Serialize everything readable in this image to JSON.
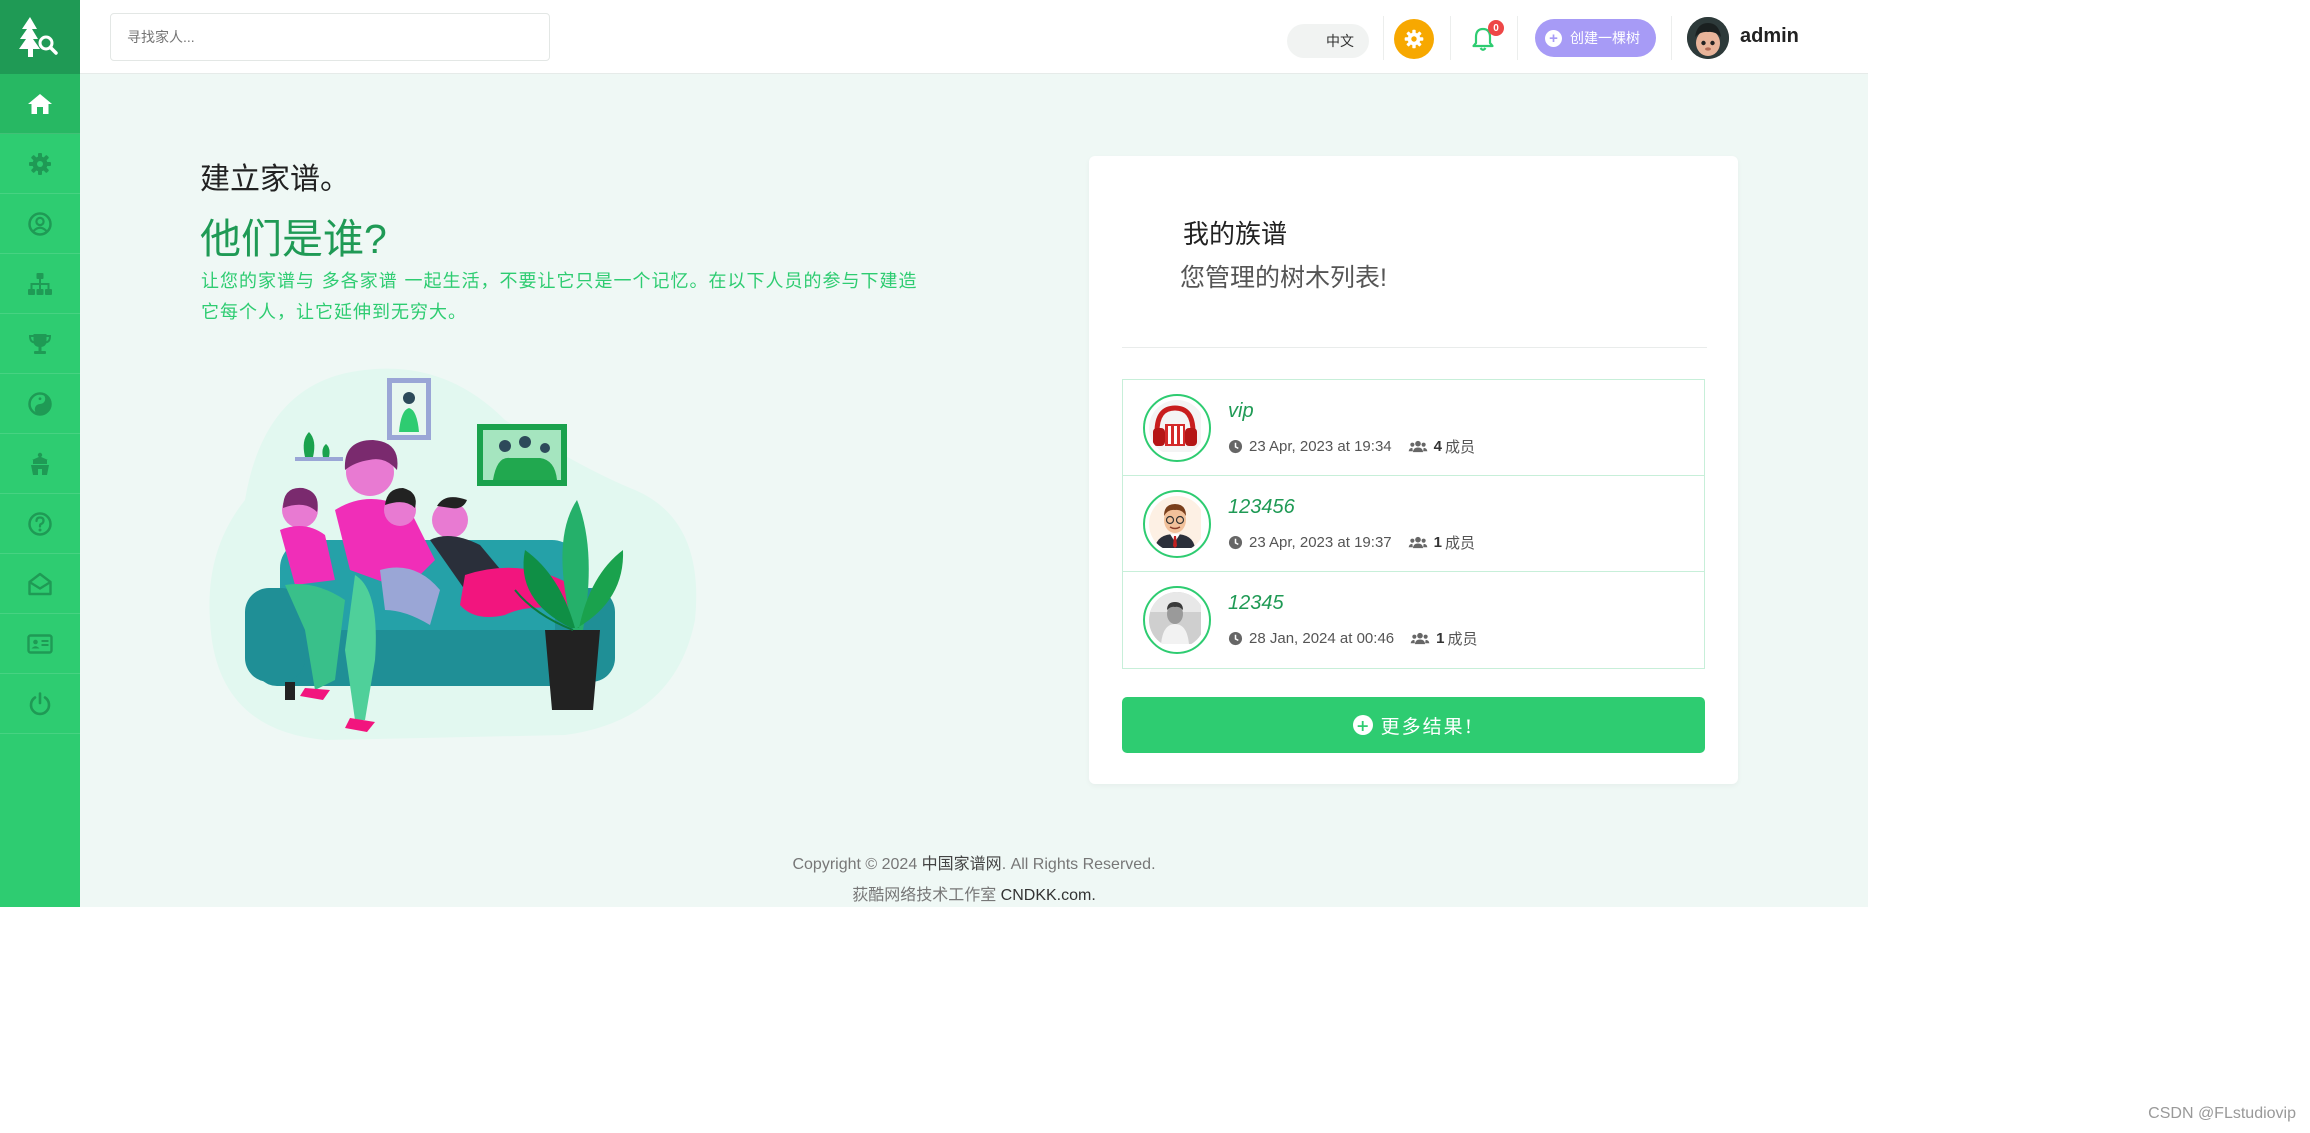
{
  "header": {
    "search_placeholder": "寻找家人...",
    "language": "中文",
    "notification_count": "0",
    "create_button": "创建一棵树",
    "user_name": "admin"
  },
  "sidebar": {
    "items": [
      {
        "icon": "home-icon",
        "active": true
      },
      {
        "icon": "gear-icon",
        "active": false
      },
      {
        "icon": "user-circle-icon",
        "active": false
      },
      {
        "icon": "sitemap-icon",
        "active": false
      },
      {
        "icon": "trophy-icon",
        "active": false
      },
      {
        "icon": "yin-yang-icon",
        "active": false
      },
      {
        "icon": "temple-icon",
        "active": false
      },
      {
        "icon": "question-icon",
        "active": false
      },
      {
        "icon": "envelope-open-icon",
        "active": false
      },
      {
        "icon": "id-card-icon",
        "active": false
      },
      {
        "icon": "power-icon",
        "active": false
      }
    ]
  },
  "hero": {
    "headline": "建立家谱。",
    "title": "他们是谁?",
    "description": "让您的家谱与 多各家谱 一起生活，不要让它只是一个记忆。在以下人员的参与下建造它每个人，让它延伸到无穷大。"
  },
  "card": {
    "title": "我的族谱",
    "subtitle": "您管理的树木列表!",
    "trees": [
      {
        "name": "vip",
        "date": "23 Apr, 2023 at 19:34",
        "members": "4",
        "members_unit": "成员"
      },
      {
        "name": "123456",
        "date": "23 Apr, 2023 at 19:37",
        "members": "1",
        "members_unit": "成员"
      },
      {
        "name": "12345",
        "date": "28 Jan, 2024 at 00:46",
        "members": "1",
        "members_unit": "成员"
      }
    ],
    "more_button": "更多结果!"
  },
  "footer": {
    "copyright_prefix": "Copyright © 2024",
    "site_name": "中国家谱网",
    "copyright_suffix": ". All Rights Reserved.",
    "studio": "荻酷网络技术工作室",
    "studio_site": "CNDKK.com."
  },
  "watermark": "CSDN @FLstudiovip",
  "colors": {
    "brand_green": "#2ecc71",
    "dark_green": "#1f9a55",
    "accent_purple": "#a79bf6",
    "accent_orange": "#f7a800",
    "badge_red": "#ee4747"
  }
}
